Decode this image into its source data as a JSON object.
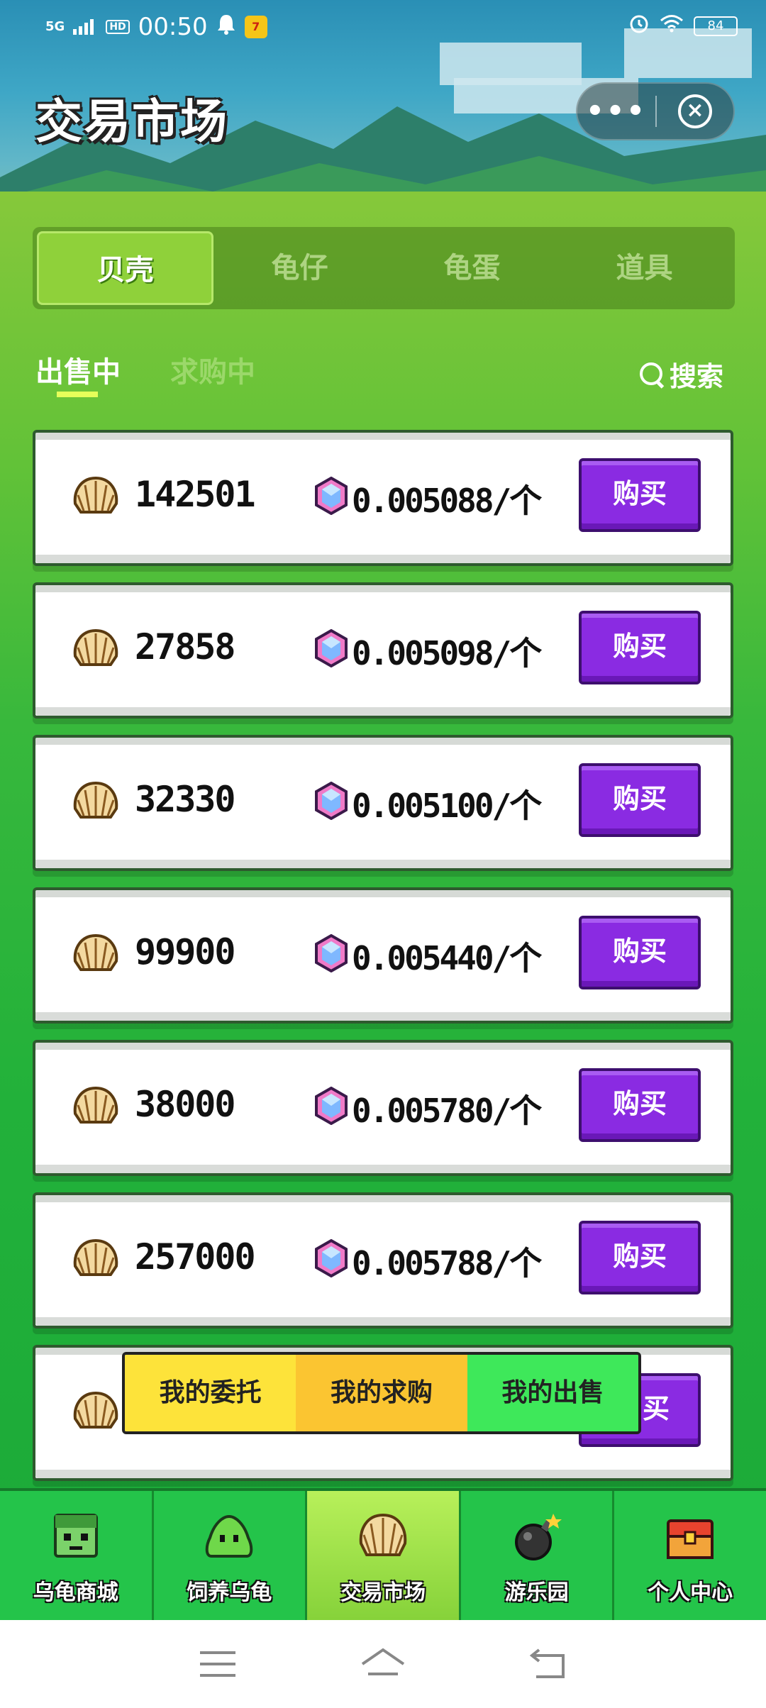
{
  "status_bar": {
    "network": "5G",
    "hd": "HD",
    "time": "00:50",
    "battery": "84"
  },
  "header": {
    "title": "交易市场"
  },
  "category_tabs": [
    {
      "label": "贝壳",
      "active": true
    },
    {
      "label": "龟仔",
      "active": false
    },
    {
      "label": "龟蛋",
      "active": false
    },
    {
      "label": "道具",
      "active": false
    }
  ],
  "sub_tabs": {
    "selling": "出售中",
    "buying": "求购中",
    "search": "搜索"
  },
  "listings": [
    {
      "quantity": "142501",
      "price": "0.005088/个",
      "button": "购买"
    },
    {
      "quantity": "27858",
      "price": "0.005098/个",
      "button": "购买"
    },
    {
      "quantity": "32330",
      "price": "0.005100/个",
      "button": "购买"
    },
    {
      "quantity": "99900",
      "price": "0.005440/个",
      "button": "购买"
    },
    {
      "quantity": "38000",
      "price": "0.005780/个",
      "button": "购买"
    },
    {
      "quantity": "257000",
      "price": "0.005788/个",
      "button": "购买"
    },
    {
      "quantity": "",
      "price": "",
      "button": "买"
    }
  ],
  "floating_bar": {
    "items": [
      "我的委托",
      "我的求购",
      "我的出售"
    ]
  },
  "bottom_nav": [
    {
      "label": "乌龟商城",
      "icon": "turtle-face-icon"
    },
    {
      "label": "饲养乌龟",
      "icon": "green-slime-icon"
    },
    {
      "label": "交易市场",
      "icon": "shell-icon",
      "active": true
    },
    {
      "label": "游乐园",
      "icon": "bomb-icon"
    },
    {
      "label": "个人中心",
      "icon": "treasure-chest-icon"
    }
  ],
  "colors": {
    "buy_button": "#8a2be2",
    "active_tab": "#8fd13a",
    "grass": "#22b13a"
  }
}
